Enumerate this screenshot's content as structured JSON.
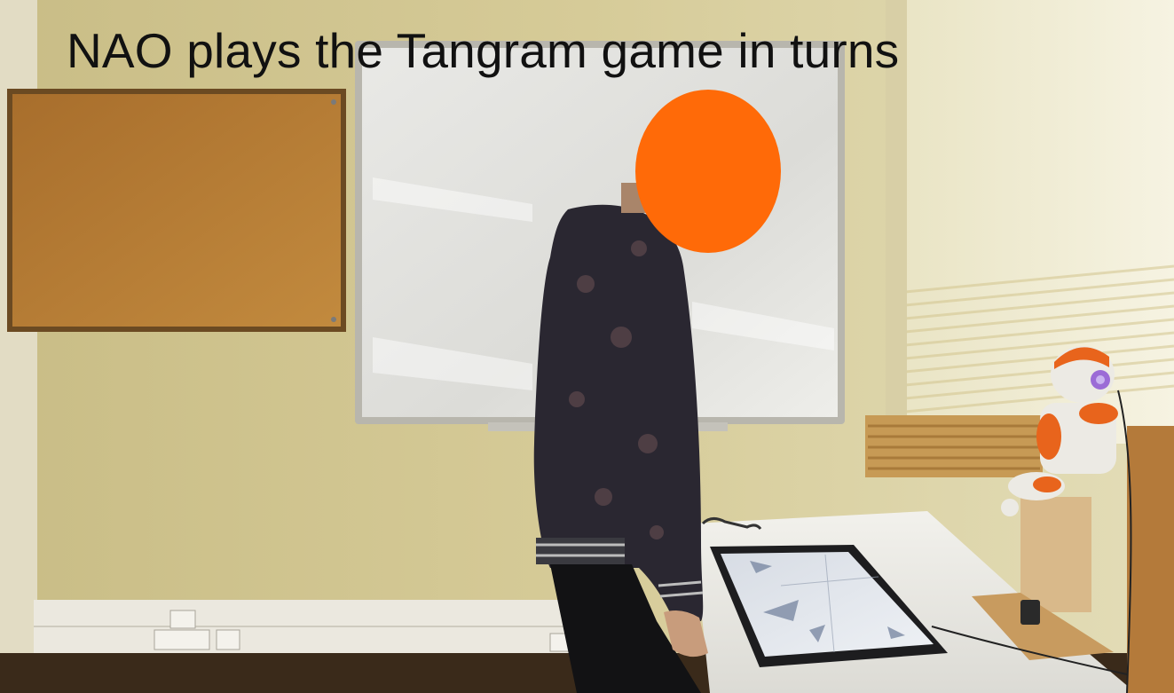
{
  "caption": "NAO plays the Tangram game in turns",
  "colors": {
    "wall": "#d9cd9a",
    "face_mask": "#ff6a08",
    "robot_orange": "#e8641c",
    "robot_white": "#eceae4",
    "robot_eye": "#9b6bd6"
  },
  "scene": {
    "objects": [
      "corkboard",
      "whiteboard",
      "window-blinds",
      "person",
      "face-mask",
      "table",
      "touchscreen-tablet",
      "nao-robot",
      "wooden-stand",
      "wall-outlets",
      "baseboard"
    ]
  }
}
